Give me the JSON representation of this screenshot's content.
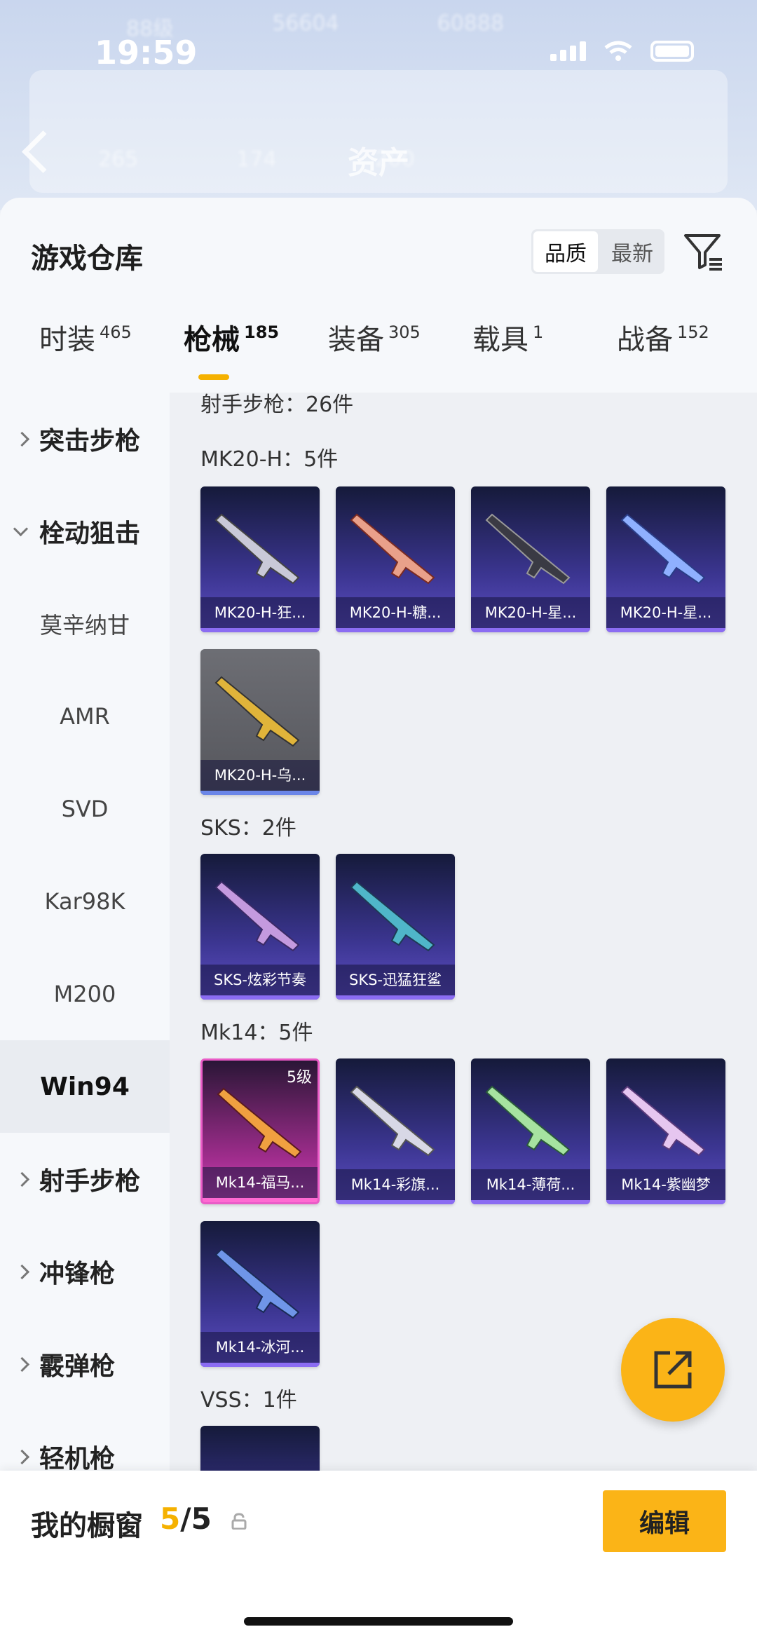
{
  "status": {
    "time": "19:59"
  },
  "header_bg": {
    "level": "88级",
    "stat_a": "56604",
    "stat_b": "60888",
    "title": "资产",
    "stat_c": "265",
    "stat_d": "174",
    "stat_e": "200"
  },
  "sheet": {
    "title": "游戏仓库",
    "sort_quality": "品质",
    "sort_latest": "最新"
  },
  "tabs": [
    {
      "label": "时装",
      "count": "465"
    },
    {
      "label": "枪械",
      "count": "185"
    },
    {
      "label": "装备",
      "count": "305"
    },
    {
      "label": "载具",
      "count": "1"
    },
    {
      "label": "战备",
      "count": "152"
    }
  ],
  "sidebar": {
    "items": [
      "突击步枪",
      "栓动狙击",
      "莫辛纳甘",
      "AMR",
      "SVD",
      "Kar98K",
      "M200",
      "Win94",
      "射手步枪",
      "冲锋枪",
      "霰弹枪",
      "轻机枪"
    ]
  },
  "content": {
    "section_header": "射手步枪：26件",
    "groups": [
      {
        "title": "MK20-H：5件",
        "items": [
          "MK20-H-狂...",
          "MK20-H-糖...",
          "MK20-H-星...",
          "MK20-H-星...",
          "MK20-H-乌..."
        ]
      },
      {
        "title": "SKS：2件",
        "items": [
          "SKS-炫彩节奏",
          "SKS-迅猛狂鲨"
        ]
      },
      {
        "title": "Mk14：5件",
        "items": [
          "Mk14-福马...",
          "Mk14-彩旗...",
          "Mk14-薄荷...",
          "Mk14-紫幽梦",
          "Mk14-冰河..."
        ],
        "level_badge": "5级"
      },
      {
        "title": "VSS：1件",
        "items": []
      }
    ]
  },
  "bottom": {
    "showcase_label": "我的橱窗",
    "count_current": "5",
    "count_sep": "/",
    "count_max": "5",
    "edit_label": "编辑"
  },
  "colors": {
    "accent": "#fbb417",
    "skin_purple": "#5e4fc5",
    "skin_pink": "#d34ab9"
  }
}
